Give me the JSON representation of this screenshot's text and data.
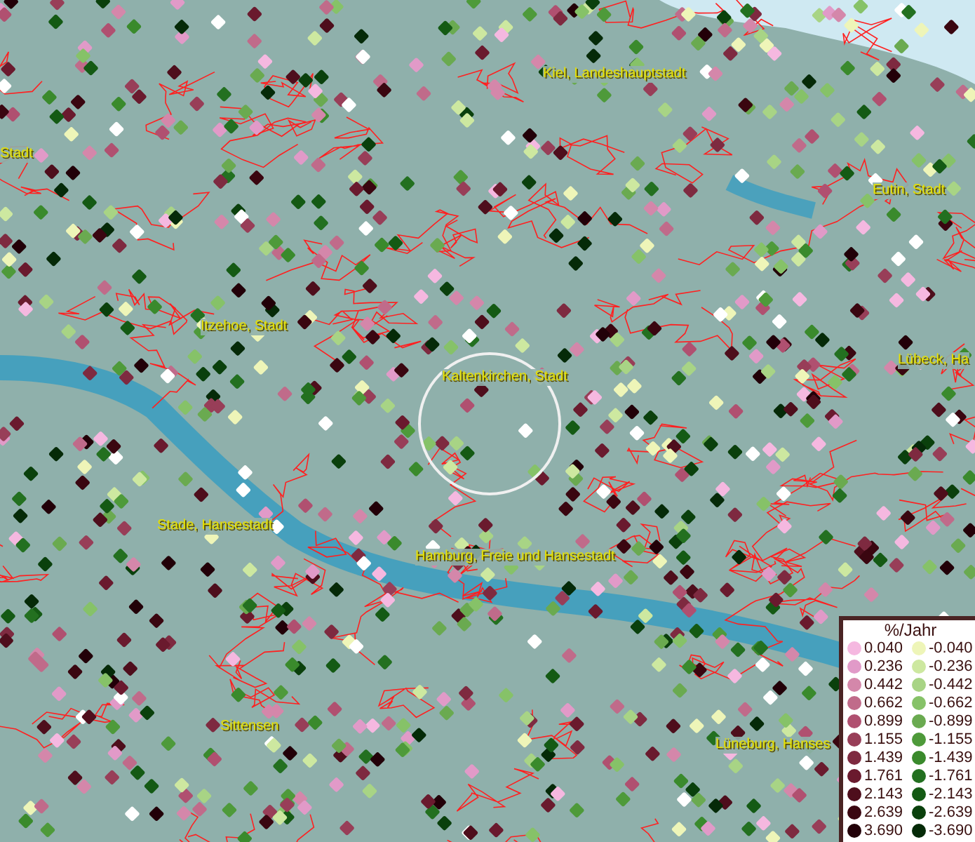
{
  "map": {
    "labels": [
      {
        "text": "Kiel, Landeshauptstadt"
      },
      {
        "text": "Stadt"
      },
      {
        "text": "Eutin, Stadt"
      },
      {
        "text": "Itzehoe, Stadt"
      },
      {
        "text": "Kaltenkirchen, Stadt"
      },
      {
        "text": "Lübeck, Ha"
      },
      {
        "text": "Stade, Hansestadt"
      },
      {
        "text": "Hamburg, Freie und Hansestadt"
      },
      {
        "text": "Sittensen"
      },
      {
        "text": "Lüneburg, Hanses"
      }
    ]
  },
  "legend": {
    "title": "%/Jahr",
    "positive": [
      {
        "value": "0.040",
        "color": "#f5b8e0"
      },
      {
        "value": "0.236",
        "color": "#e19ac8"
      },
      {
        "value": "0.442",
        "color": "#d487aa"
      },
      {
        "value": "0.662",
        "color": "#c06b8a"
      },
      {
        "value": "0.899",
        "color": "#b05070"
      },
      {
        "value": "1.155",
        "color": "#983e58"
      },
      {
        "value": "1.439",
        "color": "#7e2a40"
      },
      {
        "value": "1.761",
        "color": "#6a1a2e"
      },
      {
        "value": "2.143",
        "color": "#4e0e1c"
      },
      {
        "value": "2.639",
        "color": "#3a0610"
      },
      {
        "value": "3.690",
        "color": "#220008"
      }
    ],
    "negative": [
      {
        "value": "-0.040",
        "color": "#eef5b8"
      },
      {
        "value": "-0.236",
        "color": "#cde8a0"
      },
      {
        "value": "-0.442",
        "color": "#a8d485"
      },
      {
        "value": "-0.662",
        "color": "#86c268"
      },
      {
        "value": "-0.899",
        "color": "#6aaa50"
      },
      {
        "value": "-1.155",
        "color": "#4e9a3a"
      },
      {
        "value": "-1.439",
        "color": "#3a8a2c"
      },
      {
        "value": "-1.761",
        "color": "#237020"
      },
      {
        "value": "-2.143",
        "color": "#145a14"
      },
      {
        "value": "-2.639",
        "color": "#0a400c"
      },
      {
        "value": "-3.690",
        "color": "#052a08"
      }
    ]
  }
}
